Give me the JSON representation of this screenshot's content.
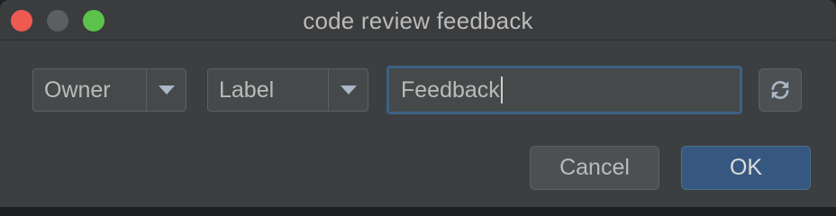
{
  "window": {
    "title": "code review feedback"
  },
  "filters": {
    "owner": {
      "selected": "Owner"
    },
    "label": {
      "selected": "Label"
    },
    "search": {
      "value": "Feedback"
    }
  },
  "icons": {
    "refresh": "refresh-icon",
    "dropdown": "chevron-down-icon"
  },
  "buttons": {
    "cancel": "Cancel",
    "ok": "OK"
  },
  "colors": {
    "background": "#3c3f41",
    "accent": "#365880",
    "focus_border": "#3d6185",
    "close": "#ee5a52",
    "zoom": "#5bc34b"
  }
}
